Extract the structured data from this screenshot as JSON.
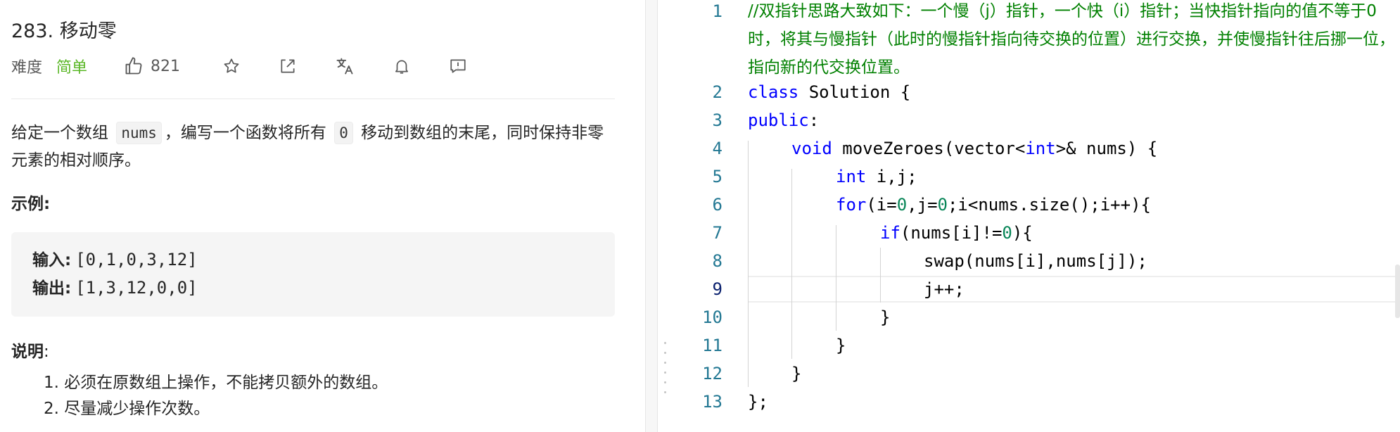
{
  "problem": {
    "title": "283. 移动零",
    "difficulty_label": "难度",
    "difficulty_value": "简单",
    "likes": "821",
    "description_part1": "给定一个数组 ",
    "description_code1": "nums",
    "description_part2": "，编写一个函数将所有 ",
    "description_code2": "0",
    "description_part3": " 移动到数组的末尾，同时保持非零元素的相对顺序。",
    "example_label": "示例:",
    "input_label": "输入:",
    "input_value": "[0,1,0,3,12]",
    "output_label": "输出:",
    "output_value": "[1,3,12,0,0]",
    "note_label": "说明",
    "note_colon": ":",
    "notes": [
      "1. 必须在原数组上操作，不能拷贝额外的数组。",
      "2. 尽量减少操作次数。"
    ]
  },
  "icons": [
    "thumbs-up-icon",
    "star-icon",
    "share-icon",
    "translate-icon",
    "bell-icon",
    "feedback-icon"
  ],
  "editor": {
    "comment": "//双指针思路大致如下：一个慢（j）指针，一个快（i）指针；当快指针指向的值不等于0时，将其与慢指针（此时的慢指针指向待交换的位置）进行交换，并使慢指针往后挪一位，指向新的代交换位置。",
    "line_numbers": [
      "1",
      "2",
      "3",
      "4",
      "5",
      "6",
      "7",
      "8",
      "9",
      "10",
      "11",
      "12",
      "13"
    ],
    "tokens": {
      "l2_kw": "class",
      "l2_rest": " Solution {",
      "l3_kw": "public",
      "l3_rest": ":",
      "l4_kw1": "void",
      "l4_mid": " moveZeroes(vector<",
      "l4_kw2": "int",
      "l4_rest": ">& nums) {",
      "l5_kw": "int",
      "l5_rest": " i,j;",
      "l6_kw": "for",
      "l6_a": "(i=",
      "l6_n1": "0",
      "l6_b": ",j=",
      "l6_n2": "0",
      "l6_rest": ";i<nums.size();i++){",
      "l7_kw": "if",
      "l7_a": "(nums[i]!=",
      "l7_n": "0",
      "l7_rest": "){",
      "l8": "swap(nums[i],nums[j]);",
      "l9": "j++;",
      "l10": "}",
      "l11": "}",
      "l12": "}",
      "l13": "};"
    }
  },
  "colors": {
    "easy": "#5ab726",
    "keyword": "#0000ff",
    "comment": "#008000",
    "number": "#098658",
    "line_number": "#237893"
  }
}
